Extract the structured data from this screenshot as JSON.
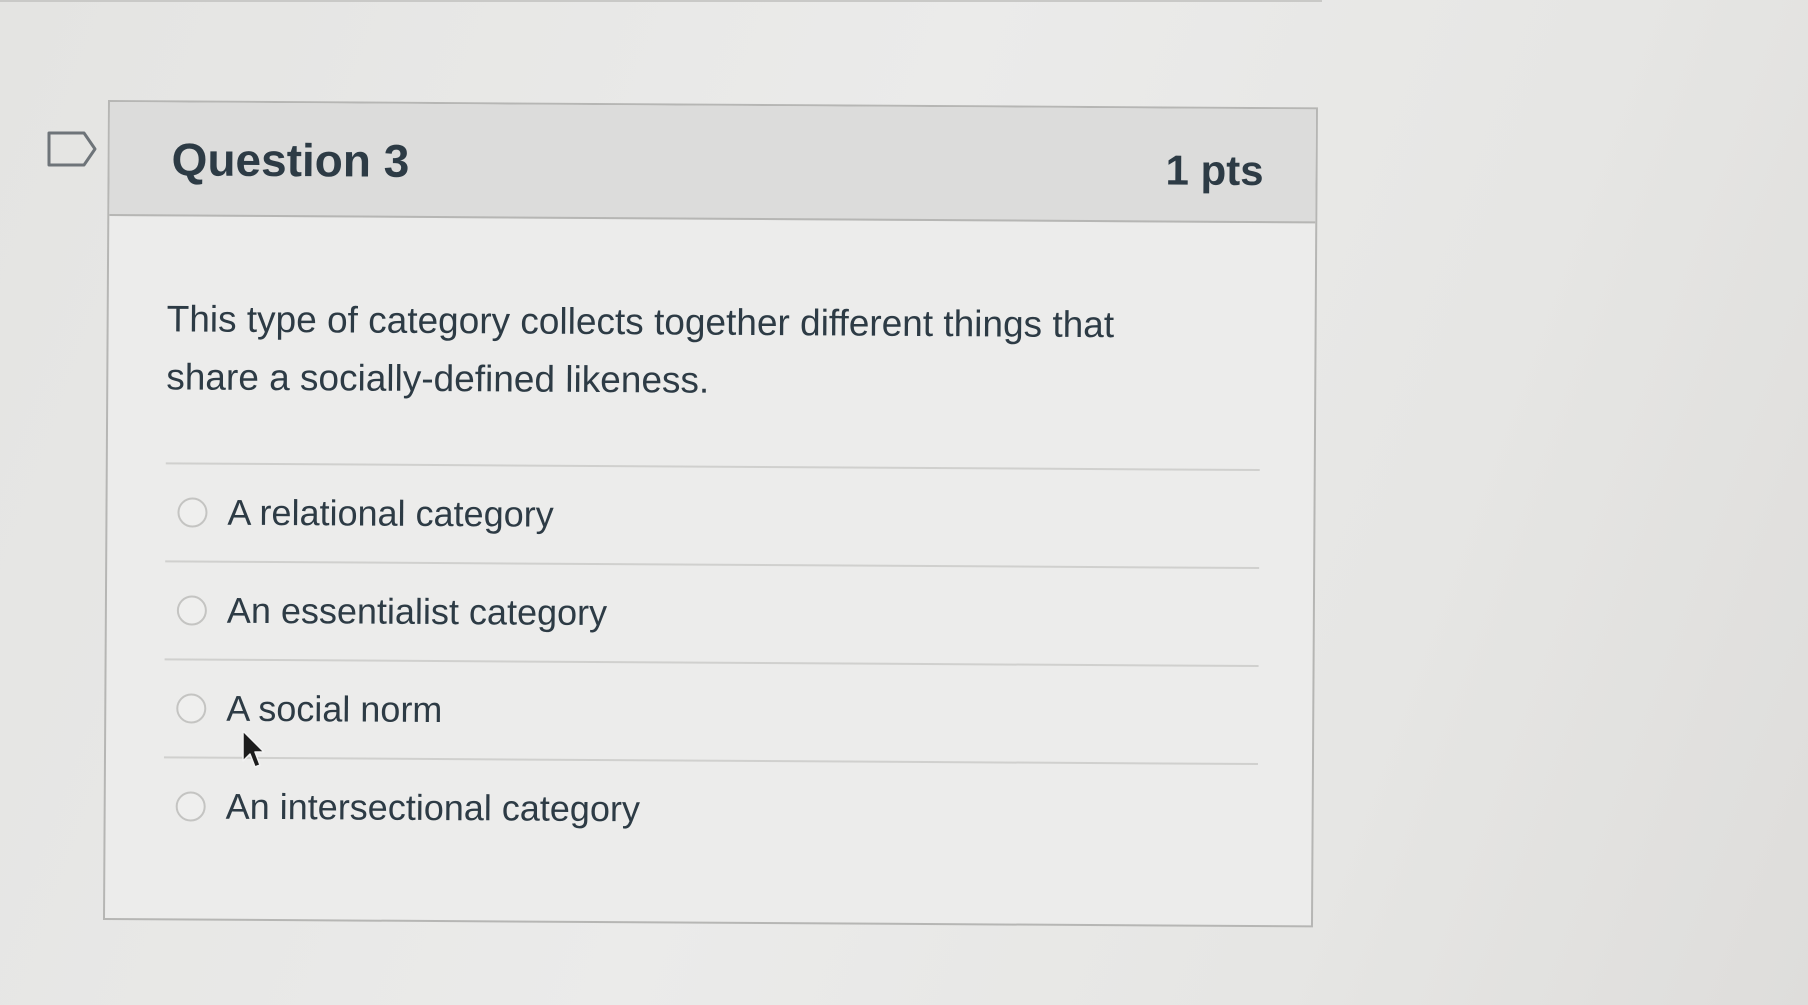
{
  "question": {
    "title": "Question 3",
    "points": "1 pts",
    "text": "This type of category collects together different things that share a socially-defined likeness.",
    "flag_icon": "flag-outline-icon"
  },
  "answers": [
    {
      "label": "A relational category",
      "selected": false
    },
    {
      "label": "An essentialist category",
      "selected": false
    },
    {
      "label": "A social norm",
      "selected": false
    },
    {
      "label": "An intersectional category",
      "selected": false
    }
  ],
  "colors": {
    "text": "#2d3b45",
    "header_bg": "#dcdcdb",
    "card_bg": "#ececeb",
    "border": "#b6b6b4"
  }
}
